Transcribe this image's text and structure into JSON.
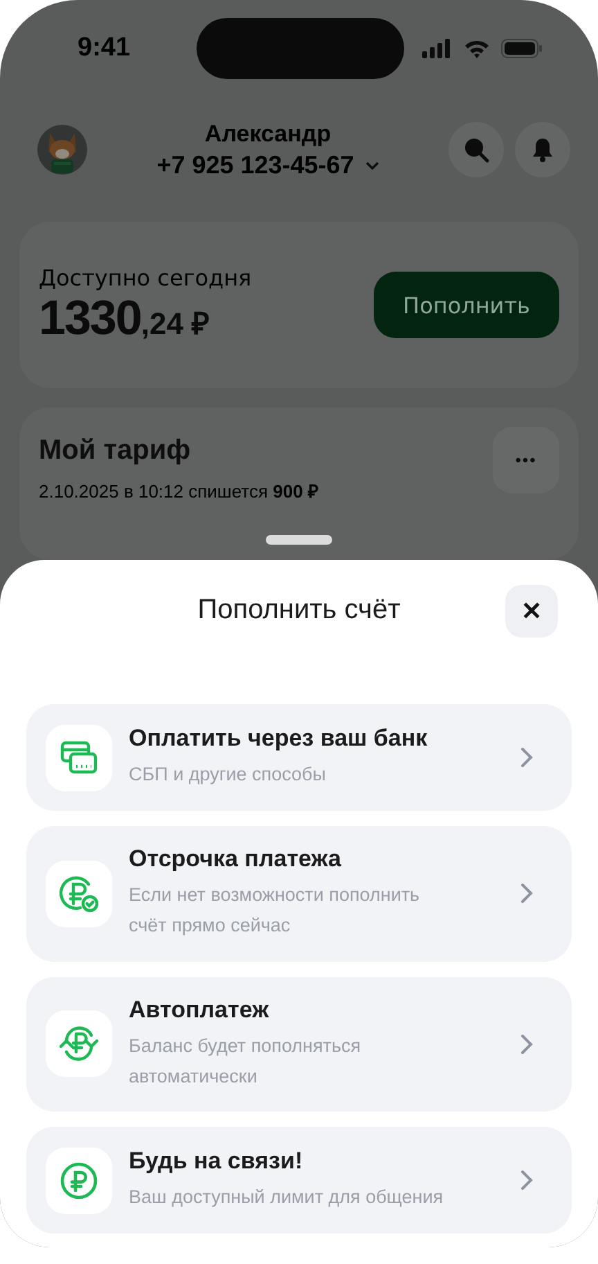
{
  "status_bar": {
    "time": "9:41"
  },
  "header": {
    "name": "Александр",
    "phone": "+7 925 123-45-67"
  },
  "balance": {
    "label": "Доступно сегодня",
    "amount_whole": "1330",
    "amount_fraction": ",24 ₽",
    "button": "Пополнить"
  },
  "tariff": {
    "title": "Мой тариф",
    "subtitle": "2.10.2025 в 10:12 спишется **900 ₽**",
    "more": "•••"
  },
  "sheet": {
    "title": "Пополнить счёт",
    "close": "✕",
    "items": [
      {
        "kind": "card",
        "title": "Оплатить через ваш банк",
        "subtitle": "СБП и другие способы"
      },
      {
        "kind": "deferral",
        "title": "Отсрочка платежа",
        "subtitle": "Если нет возможности пополнить счёт прямо сейчас"
      },
      {
        "kind": "autopay",
        "title": "Автоплатеж",
        "subtitle": "Баланс будет пополняться автоматически"
      },
      {
        "kind": "ruble",
        "title": "Будь на связи!",
        "subtitle": "Ваш доступный лимит для общения"
      }
    ]
  }
}
